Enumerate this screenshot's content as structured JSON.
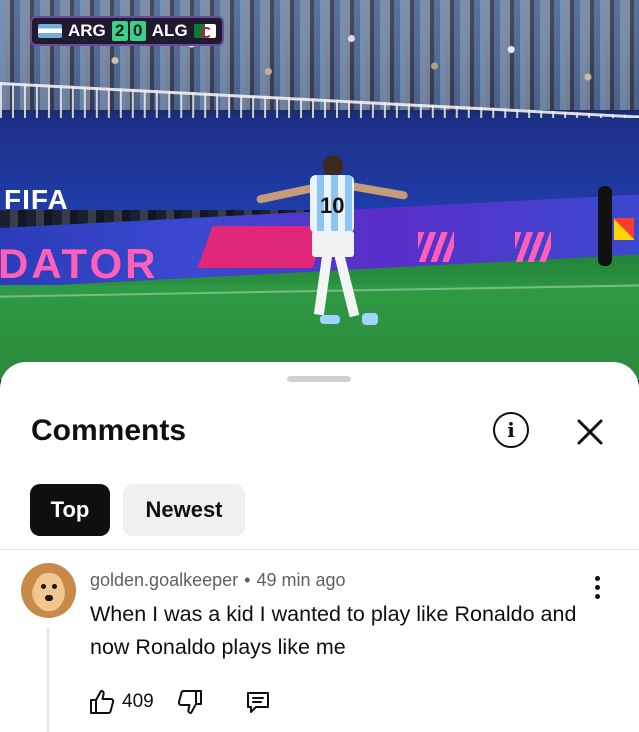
{
  "video": {
    "scoreboard": {
      "home_team": "ARG",
      "home_goals": [
        "2"
      ],
      "away_goals": [
        "0"
      ],
      "away_team": "ALG",
      "home_flag_icon": "argentina-flag-icon",
      "away_flag_icon": "algeria-flag-icon"
    },
    "board_fifa": "FIFA",
    "board_ad": "DATOR",
    "jersey_number": "10"
  },
  "comments_sheet": {
    "title": "Comments",
    "info_icon": "info-icon",
    "close_icon": "close-icon",
    "sort_chips": [
      {
        "label": "Top",
        "selected": true
      },
      {
        "label": "Newest",
        "selected": false
      }
    ],
    "comments": [
      {
        "author": "golden.goalkeeper",
        "separator": "•",
        "time": "49 min ago",
        "text": "When I was a kid I wanted to play like Ronaldo and now Ronaldo plays like me",
        "like_count": "409",
        "avatar_icon": "golden-retriever-avatar"
      }
    ]
  },
  "colors": {
    "text_primary": "#0f0f0f",
    "text_secondary": "#606060",
    "chip_selected_bg": "#0f0f0f",
    "chip_bg": "#f0f0f0",
    "score_green": "#3bd18a"
  }
}
